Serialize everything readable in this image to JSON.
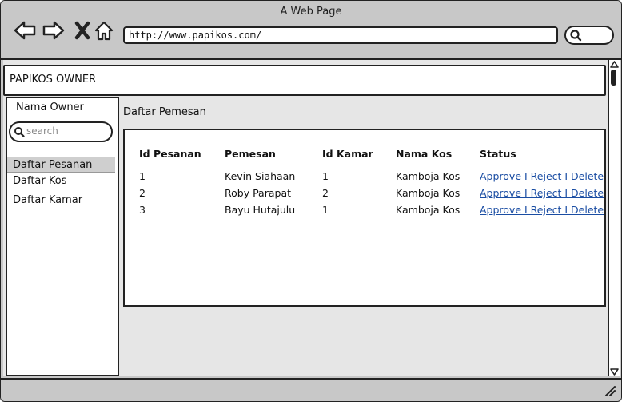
{
  "window": {
    "title": "A Web Page"
  },
  "browser": {
    "url": "http://www.papikos.com/"
  },
  "app": {
    "brand": "PAPIKOS OWNER"
  },
  "sidebar": {
    "owner": "Nama Owner",
    "search_placeholder": "search",
    "items": [
      {
        "label": "Daftar Pesanan",
        "active": true
      },
      {
        "label": "Daftar Kos",
        "active": false
      },
      {
        "label": "Daftar Kamar",
        "active": false
      }
    ]
  },
  "main": {
    "title": "Daftar Pemesan",
    "table": {
      "headers": [
        "Id Pesanan",
        "Pemesan",
        "Id Kamar",
        "Nama Kos",
        "Status"
      ],
      "rows": [
        [
          "1",
          "Kevin Siahaan",
          "1",
          "Kamboja Kos",
          "Approve I Reject I Delete"
        ],
        [
          "2",
          "Roby Parapat",
          "2",
          "Kamboja Kos",
          "Approve I Reject I Delete"
        ],
        [
          "3",
          "Bayu Hutajulu",
          "1",
          "Kamboja Kos",
          "Approve I Reject I Delete"
        ]
      ]
    }
  },
  "colors": {
    "link": "#1a4da3",
    "chrome": "#c8c8c8",
    "border": "#222222"
  }
}
